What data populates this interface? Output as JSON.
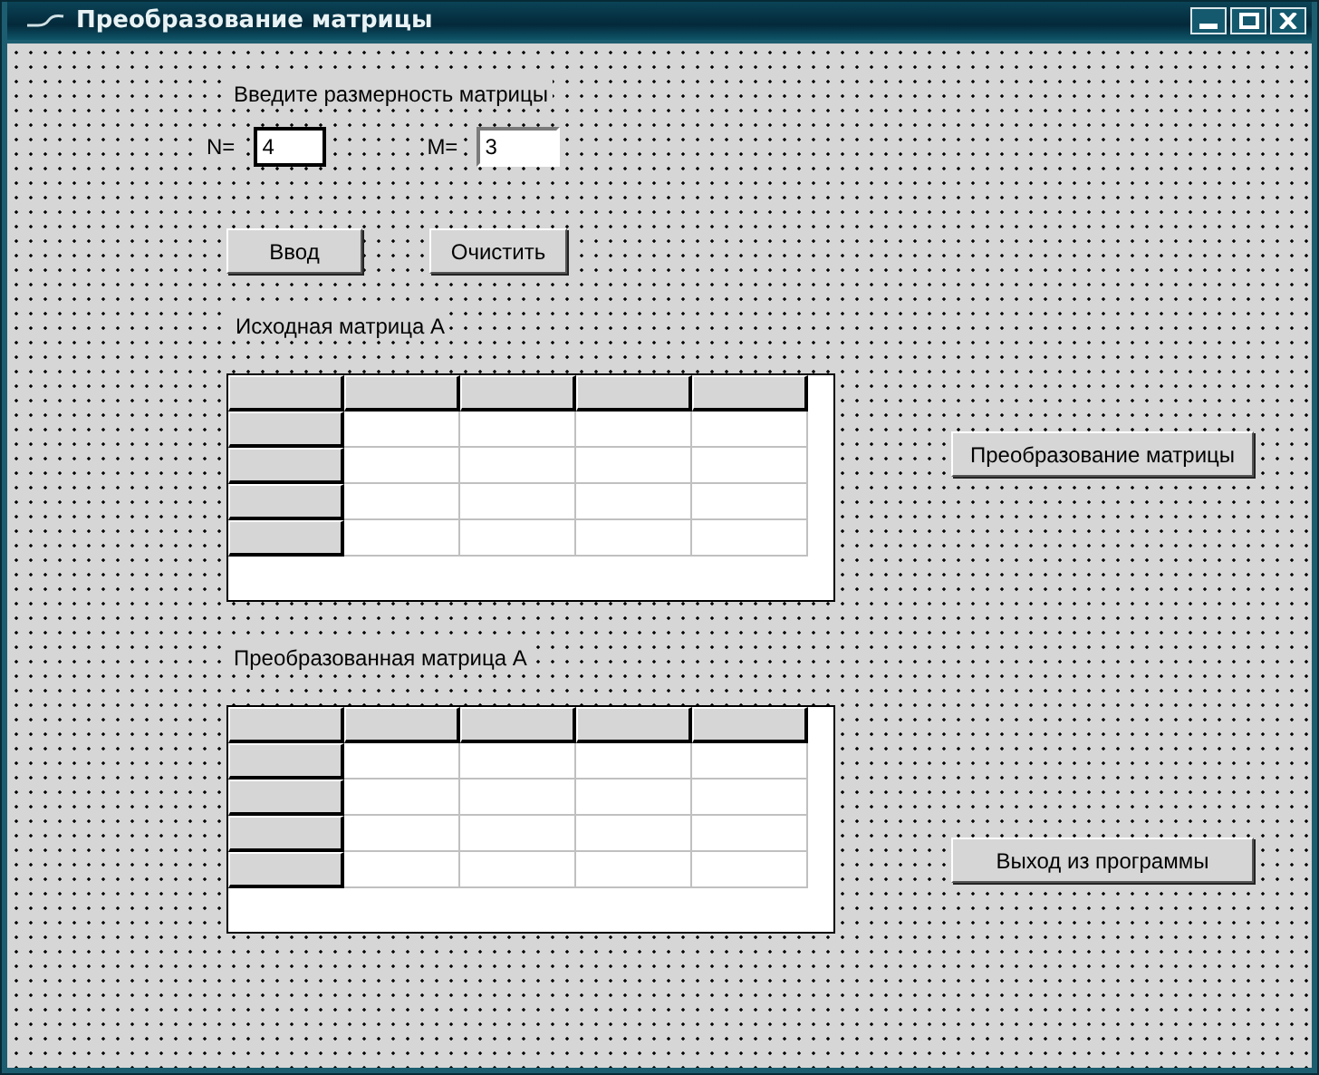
{
  "window": {
    "title": "Преобразование матрицы"
  },
  "size_prompt": "Введите размерность матрицы",
  "fields": [
    {
      "label": "N=",
      "value": "4",
      "focused": true
    },
    {
      "label": "M=",
      "value": "3",
      "focused": false
    }
  ],
  "buttons": [
    "Ввод",
    "Очистить"
  ],
  "matrices": [
    {
      "title": "Исходная матрица А",
      "action": "Преобразование матрицы"
    },
    {
      "title": "Преобразованная матрица А",
      "action": "Выход из программы"
    }
  ]
}
